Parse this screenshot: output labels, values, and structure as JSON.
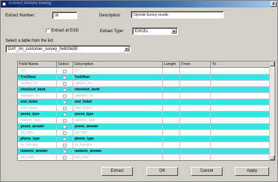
{
  "window": {
    "title": "Extract Details Dialog",
    "close_label": "x"
  },
  "form": {
    "extract_number_label": "Extract Number:",
    "extract_number_value": "36",
    "description_label": "Description:",
    "description_value": "Opcode Survey results",
    "extract_at_eod_label": "Extract at EOD",
    "extract_type_label": "Extract Type:",
    "extract_type_value": "EXCEL",
    "select_table_label": "Select a table from the list:",
    "table_value": "DAY_trn_customer_survey_0x600e5E"
  },
  "grid": {
    "columns": [
      "Field Name",
      "Select",
      "Description",
      "Length",
      "From",
      "To"
    ],
    "rows": [
      {
        "name": "DT",
        "desc": "DT",
        "highlight": false,
        "marker": ""
      },
      {
        "name": "TrnOffset",
        "desc": "TrnOffset",
        "highlight": true,
        "marker": "✓"
      },
      {
        "name": "cashier_no",
        "desc": "cashier_no",
        "highlight": false,
        "marker": ""
      },
      {
        "name": "checkout_bank",
        "desc": "checkout_bank",
        "highlight": true,
        "marker": ""
      },
      {
        "name": "question_no",
        "desc": "question_no",
        "highlight": false,
        "marker": ""
      },
      {
        "name": "end_ticket",
        "desc": "end_ticket",
        "highlight": true,
        "marker": ""
      },
      {
        "name": "start_ticket",
        "desc": "start_ticket",
        "highlight": false,
        "marker": ""
      },
      {
        "name": "yesno_type",
        "desc": "yesno_type",
        "highlight": true,
        "marker": ""
      },
      {
        "name": "numeric_type",
        "desc": "numeric_type",
        "highlight": false,
        "marker": ""
      },
      {
        "name": "yesno_answer",
        "desc": "yesno_answer",
        "highlight": true,
        "marker": ""
      },
      {
        "name": "zip_type",
        "desc": "zip_type",
        "highlight": false,
        "marker": ""
      },
      {
        "name": "phone_type",
        "desc": "phone_type",
        "highlight": true,
        "marker": ""
      },
      {
        "name": "by_function",
        "desc": "by_function",
        "highlight": false,
        "marker": ""
      },
      {
        "name": "numeric_answer",
        "desc": "numeric_answer",
        "highlight": true,
        "marker": ""
      },
      {
        "name": "zip_code",
        "desc": "zip_code",
        "highlight": false,
        "marker": ""
      }
    ]
  },
  "buttons": {
    "extract": "Extract",
    "ok": "OK",
    "cancel": "Cancel",
    "apply": "Apply"
  },
  "colors": {
    "highlight_row": "#33e6e6",
    "titlebar": "#0a246a"
  }
}
